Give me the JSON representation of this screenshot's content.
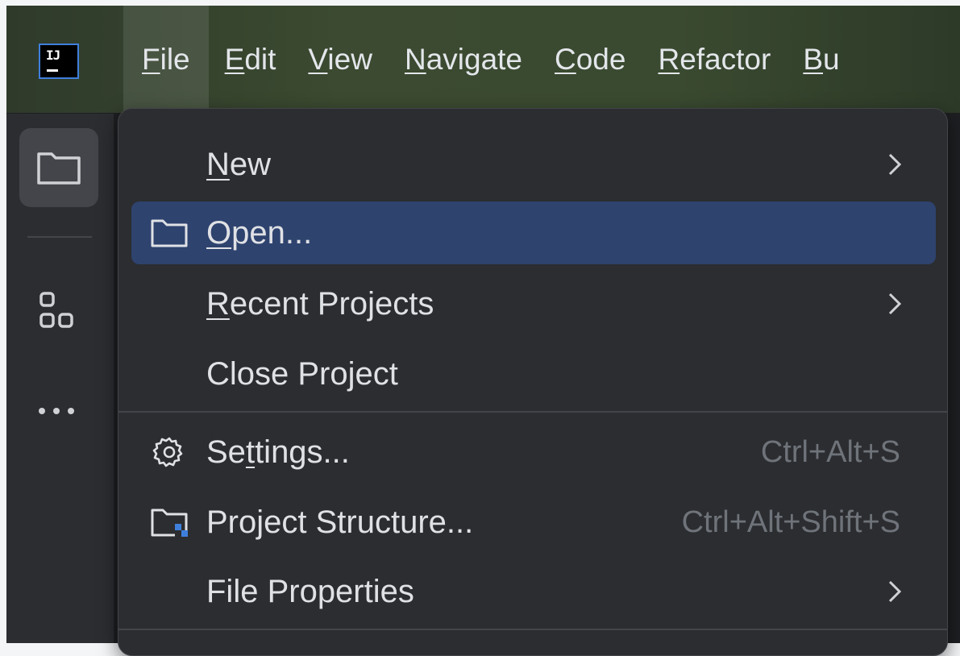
{
  "app": {
    "logo_text": "IJ"
  },
  "menubar": {
    "items": [
      {
        "label": "File",
        "mnemonic_index": 0,
        "active": true
      },
      {
        "label": "Edit",
        "mnemonic_index": 0
      },
      {
        "label": "View",
        "mnemonic_index": 0
      },
      {
        "label": "Navigate",
        "mnemonic_index": 0
      },
      {
        "label": "Code",
        "mnemonic_index": 0
      },
      {
        "label": "Refactor",
        "mnemonic_index": 0
      },
      {
        "label": "Bu",
        "mnemonic_index": 0
      }
    ]
  },
  "sidebar": {
    "items": [
      {
        "name": "project",
        "icon": "folder-icon",
        "active": true
      },
      {
        "name": "structure",
        "icon": "structure-icon"
      },
      {
        "name": "more",
        "icon": "more-icon"
      }
    ]
  },
  "file_menu": {
    "items": [
      {
        "pre": "",
        "u": "N",
        "post": "ew",
        "shortcut": "",
        "submenu": true,
        "icon": ""
      },
      {
        "pre": "",
        "u": "O",
        "post": "pen...",
        "shortcut": "",
        "submenu": false,
        "icon": "folder-icon",
        "selected": true
      },
      {
        "pre": "",
        "u": "R",
        "post": "ecent Projects",
        "shortcut": "",
        "submenu": true,
        "icon": ""
      },
      {
        "pre": "Close Project",
        "u": "",
        "post": "",
        "shortcut": "",
        "submenu": false,
        "icon": ""
      },
      {
        "pre": "Se",
        "u": "t",
        "post": "tings...",
        "shortcut": "Ctrl+Alt+S",
        "submenu": false,
        "icon": "gear-icon"
      },
      {
        "pre": "Project Structure...",
        "u": "",
        "post": "",
        "shortcut": "Ctrl+Alt+Shift+S",
        "submenu": false,
        "icon": "project-structure-icon"
      },
      {
        "pre": "File Properties",
        "u": "",
        "post": "",
        "shortcut": "",
        "submenu": true,
        "icon": ""
      }
    ]
  },
  "colors": {
    "accent": "#3f7fdc",
    "selection": "#2e436e",
    "menu_bg": "#2b2d30",
    "text": "#dfe1e5",
    "shortcut_text": "#6f737a"
  }
}
